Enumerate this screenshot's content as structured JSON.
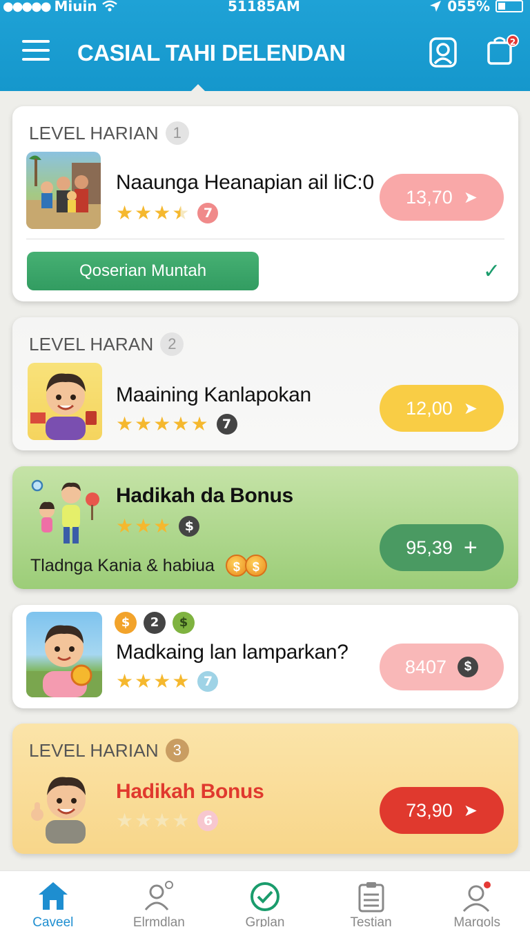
{
  "status_bar": {
    "carrier": "Miuin",
    "time": "51185AM",
    "battery": "055%"
  },
  "header": {
    "title": "CASIAL TAHI DELENDAN",
    "bag_badge": "2"
  },
  "cards": [
    {
      "level_label": "LEVEL HARIAN",
      "level_number": "1",
      "title": "Naaunga Heanapian ail liC:0",
      "stars": 3.5,
      "badge": "7",
      "price": "13,70",
      "action_button": "Qoserian Muntah",
      "colors": {
        "pill": "#f9a8a8",
        "badge": "#f08a8a"
      }
    },
    {
      "level_label": "LEVEL HARAN",
      "level_number": "2",
      "title": "Maaining Kanlapokan",
      "stars": 5,
      "badge": "7",
      "price": "12,00",
      "colors": {
        "pill": "#f9cd45",
        "badge": "#444444"
      }
    },
    {
      "title": "Hadikah da Bonus",
      "stars": 3,
      "badge": "$",
      "subtext": "Tladnga Kania & habiua",
      "price": "95,39",
      "colors": {
        "pill": "#4a9a62",
        "badge": "#444444"
      }
    },
    {
      "title": "Madkaing lan lamparkan?",
      "stars": 4,
      "badge": "7",
      "mini_badges": [
        "$",
        "2",
        "$"
      ],
      "price": "8407",
      "colors": {
        "pill": "#f9b8b8",
        "badge": "#9fd3e6"
      }
    },
    {
      "level_label": "LEVEL HARIAN",
      "level_number": "3",
      "title": "Hadikah Bonus",
      "stars": 4,
      "badge": "6",
      "price": "73,90",
      "colors": {
        "pill": "#e0392e",
        "badge": "#f7c7cf",
        "title": "#e0392e"
      }
    }
  ],
  "bottom_nav": [
    {
      "label": "Caveel",
      "icon": "home-icon"
    },
    {
      "label": "Elrmdlan",
      "icon": "user-icon"
    },
    {
      "label": "Grplan",
      "icon": "check-circle-icon"
    },
    {
      "label": "Testian",
      "icon": "clipboard-icon"
    },
    {
      "label": "Margols",
      "icon": "profile-icon"
    }
  ]
}
